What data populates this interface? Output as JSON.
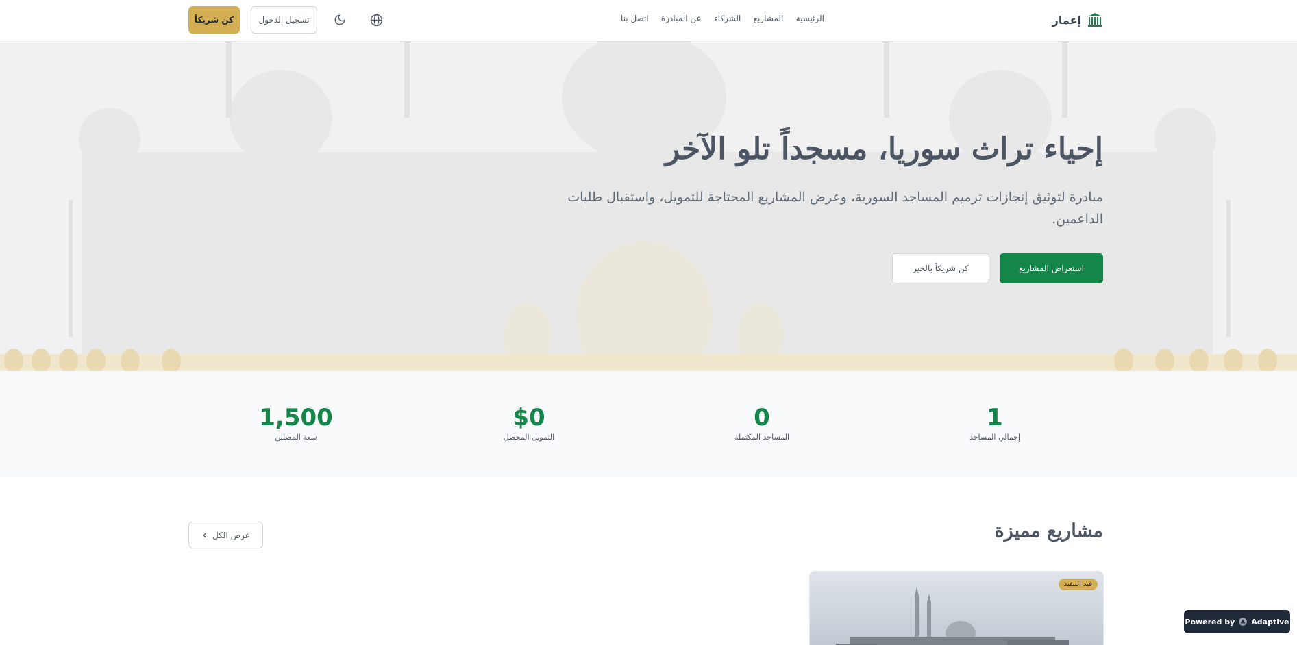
{
  "nav": {
    "brand": "إعمار",
    "links": [
      "الرئيسية",
      "المشاريع",
      "الشركاء",
      "عن المبادرة",
      "اتصل بنا"
    ],
    "login_label": "تسجيل الدخول",
    "partner_label": "كن شريكاً"
  },
  "hero": {
    "title": "إحياء تراث سوريا، مسجداً تلو الآخر",
    "subtitle": "مبادرة لتوثيق إنجازات ترميم المساجد السورية، وعرض المشاريع المحتاجة للتمويل، واستقبال طلبات الداعمين.",
    "primary_button": "استعراض المشاريع",
    "secondary_button": "كن شريكاً بالخير"
  },
  "stats": [
    {
      "value": "1",
      "label": "إجمالي المساجد"
    },
    {
      "value": "0",
      "label": "المساجد المكتملة"
    },
    {
      "value": "$0",
      "label": "التمويل المحصل"
    },
    {
      "value": "1,500",
      "label": "سعة المصلين"
    }
  ],
  "featured": {
    "title": "مشاريع مميزة",
    "view_all_label": "عرض الكل",
    "card_badge": "قيد التنفيذ"
  },
  "powered_by": {
    "prefix": "Powered by",
    "brand": "Adaptive"
  },
  "colors": {
    "primary": "#14864a",
    "accent": "#d4ae52"
  }
}
